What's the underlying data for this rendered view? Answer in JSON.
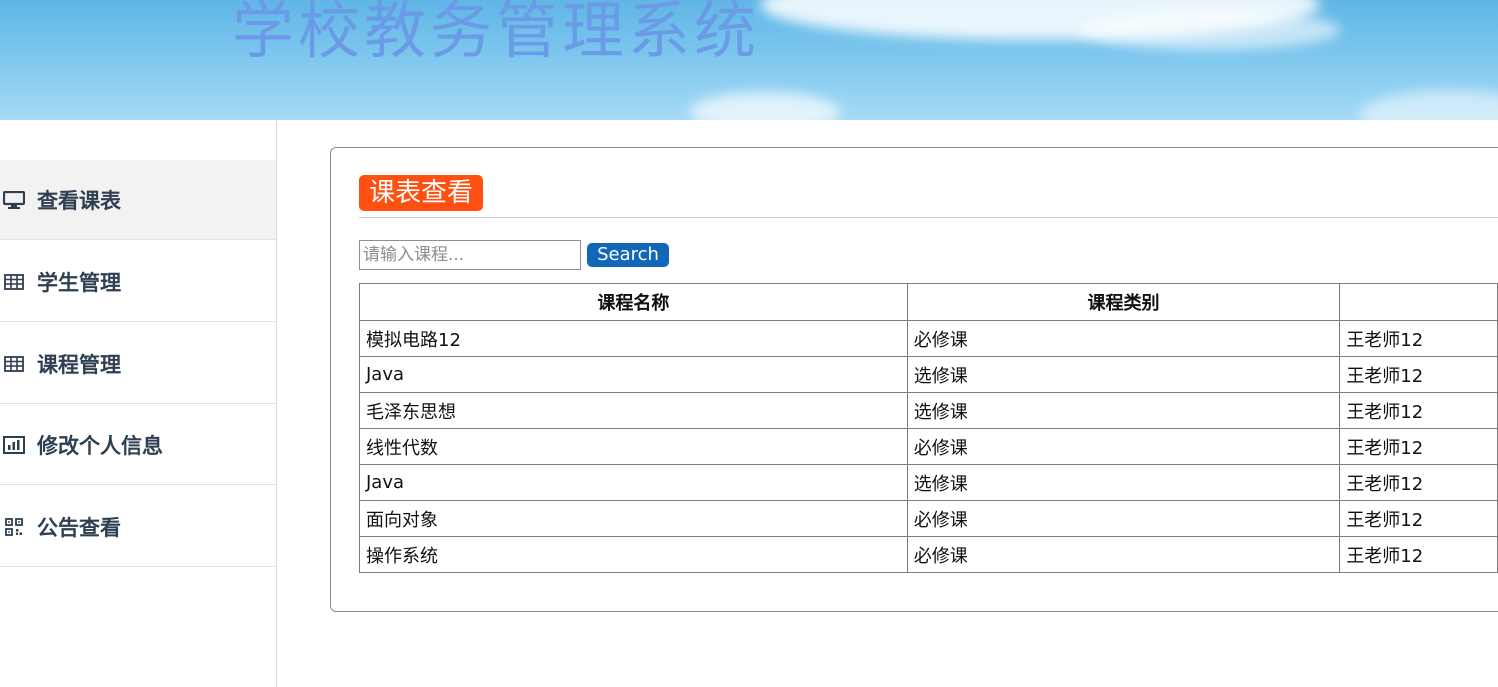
{
  "header": {
    "title": "学校教务管理系统"
  },
  "sidebar": {
    "items": [
      {
        "label": "查看课表",
        "icon": "monitor-icon",
        "active": true
      },
      {
        "label": "学生管理",
        "icon": "table-icon",
        "active": false
      },
      {
        "label": "课程管理",
        "icon": "table-icon",
        "active": false
      },
      {
        "label": "修改个人信息",
        "icon": "bar-chart-icon",
        "active": false
      },
      {
        "label": "公告查看",
        "icon": "qrcode-icon",
        "active": false
      }
    ]
  },
  "main": {
    "title": "课表查看",
    "search": {
      "placeholder": "请输入课程...",
      "value": "",
      "button_label": "Search"
    },
    "table": {
      "columns": [
        "课程名称",
        "课程类别",
        ""
      ],
      "rows": [
        [
          "模拟电路12",
          "必修课",
          "王老师12"
        ],
        [
          "Java",
          "选修课",
          "王老师12"
        ],
        [
          "毛泽东思想",
          "选修课",
          "王老师12"
        ],
        [
          "线性代数",
          "必修课",
          "王老师12"
        ],
        [
          "Java",
          "选修课",
          "王老师12"
        ],
        [
          "面向对象",
          "必修课",
          "王老师12"
        ],
        [
          "操作系统",
          "必修课",
          "王老师12"
        ]
      ]
    }
  },
  "colors": {
    "title_badge": "#ff5011",
    "search_button": "#1267b8",
    "nav_text": "#2e3f52",
    "banner_title": "#6b9be6"
  }
}
